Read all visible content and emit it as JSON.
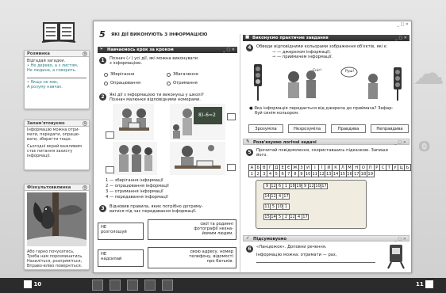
{
  "sidebar": {
    "p1": {
      "title": "Розминка",
      "lines": [
        "Відгадай загадки.",
        "• Не дерево, а з листям,",
        "  Не людина, а говорить.",
        "• Якщо не має,",
        "  А розуму навчає."
      ]
    },
    "p2": {
      "title": "Запам'ятовуємо",
      "lines": [
        "Інформацію можна отри-",
        "мати, передати, опрацю-",
        "вати, зберегти тощо.",
        "Сьогодні вкрай важливим",
        "стає питання захисту",
        "інформації."
      ]
    },
    "p3": {
      "title": "Фізкультхвилинка",
      "lines": [
        "Або гарно почухатись,",
        "Треба нам порозминатись.",
        "Нахиліться, розпряміться,",
        "Вправо-вліво поверніться."
      ]
    }
  },
  "lesson": {
    "number": "5",
    "title": "ЯКІ ДІЇ ВИКОНУЮТЬ З ІНФОРМАЦІЄЮ"
  },
  "left": {
    "bar": "Навчаємось крок за кроком",
    "q1_num": "1",
    "q1": [
      "Познач (✓) усі дії, які можна виконувати",
      "з інформацією."
    ],
    "options": [
      "Зберігання",
      "Збагачення",
      "Опрацювання",
      "Отримання"
    ],
    "q2_num": "2",
    "q2": [
      "Які дії з інформацією ти виконуєш у школі?",
      "Познач малюнки відповідними номерами."
    ],
    "legend": [
      "1 — зберігання інформації",
      "2 — опрацювання інформації",
      "3 — отримання інформації",
      "4 — передавання інформації"
    ],
    "q3_num": "3",
    "q3": [
      "Відновив правила, яких потрібно дотриму-",
      "ватися під час передавання інформації."
    ],
    "z1a": [
      "НЕ",
      "розголошуй"
    ],
    "z1b": [
      "свої та родинні",
      "фотографії незна-",
      "йомим людям."
    ],
    "z2a": [
      "НЕ",
      "надсилай"
    ],
    "z2b": [
      "свою адресу, номер",
      "телефону, відомості",
      "про батьків."
    ]
  },
  "right": {
    "bar1": "Виконуємо практичне завдання",
    "q4_num": "4",
    "q4": "Обведи відповідними кольорами зображення об'єктів, які є:",
    "src": "— джерелом інформації;",
    "rcv": "— приймачем інформації.",
    "bubble1": "Сніг!",
    "bubble2": "Руш!",
    "q4b": [
      "Яка інформація передається від джерела до приймача? Зафар-",
      "буй синім кольором."
    ],
    "btns": [
      "Зрозуміла",
      "Незрозуміла",
      "Правдива",
      "Неправдива"
    ],
    "bar2": "Розв'язуємо логічні задачі",
    "q5_num": "5",
    "q5": [
      "Прочитай повідомлення, скориставшись підказкою. Запиши",
      "його."
    ],
    "alphabet": [
      "А",
      "Б",
      "В",
      "Г",
      "Д",
      "Е",
      "Є",
      "Ж",
      "З",
      "И",
      "І",
      "Ї",
      "Й",
      "К",
      "Л",
      "М",
      "Н",
      "О",
      "П",
      "Р",
      "С",
      "Т",
      "У",
      "Ц",
      "Ь"
    ],
    "codes": [
      "1",
      "2",
      "3",
      "4",
      "5",
      "6",
      "7",
      "8",
      "9",
      "10",
      "11",
      "12",
      "13",
      "14",
      "15",
      "16",
      "17",
      "18",
      "19"
    ],
    "scroll": [
      [
        "9",
        "12",
        "6",
        "1",
        "18",
        "19",
        "9",
        "12",
        "10",
        "17"
      ],
      [
        "14",
        "12",
        "4",
        "17"
      ],
      [
        "11",
        "5",
        "10",
        "1"
      ],
      [
        "15",
        "14",
        "5",
        "2",
        "12",
        "4",
        "17"
      ]
    ],
    "bar3": "Підсумовуємо",
    "q6_num": "6",
    "q6": "«Ланцюжок». Доповни речення.",
    "q6b": "Інформацію можна: отримати — раз,"
  },
  "footer": {
    "left_page": "10",
    "right_page": "11"
  }
}
